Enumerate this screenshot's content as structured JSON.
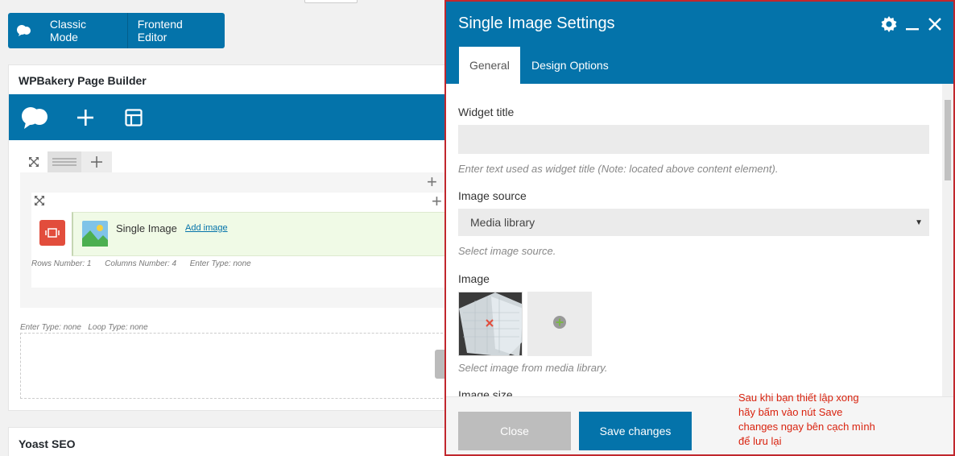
{
  "mode_bar": {
    "classic_label": "Classic Mode",
    "frontend_label": "Frontend Editor"
  },
  "builder": {
    "title": "WPBakery Page Builder",
    "element": {
      "name": "Single Image",
      "add_link": "Add image"
    },
    "meta_row": {
      "rows_label": "Rows Number:",
      "rows_value": "1",
      "cols_label": "Columns Number:",
      "cols_value": "4",
      "enter_label": "Enter Type:",
      "enter_value": "none"
    },
    "meta_row2": {
      "enter_label": "Enter Type:",
      "enter_value": "none",
      "loop_label": "Loop Type:",
      "loop_value": "none"
    }
  },
  "yoast": {
    "title": "Yoast SEO"
  },
  "modal": {
    "title": "Single Image Settings",
    "tabs": [
      {
        "label": "General"
      },
      {
        "label": "Design Options"
      }
    ],
    "fields": {
      "widget_title_label": "Widget title",
      "widget_title_value": "",
      "widget_title_help": "Enter text used as widget title (Note: located above content element).",
      "image_source_label": "Image source",
      "image_source_value": "Media library",
      "image_source_help": "Select image source.",
      "image_label": "Image",
      "image_help": "Select image from media library.",
      "image_size_label": "Image size"
    },
    "buttons": {
      "close": "Close",
      "save": "Save changes"
    },
    "note": {
      "line1": "Sau khi bạn thiết lập xong",
      "line2": "hãy bấm vào nút Save",
      "line3": "changes ngay bên cạch mình",
      "line4": "để lưu lại"
    }
  },
  "colors": {
    "brand_blue": "#0473aa",
    "red_accent": "#c1272d",
    "note_red": "#d9230f",
    "element_green": "#f0fae6"
  }
}
